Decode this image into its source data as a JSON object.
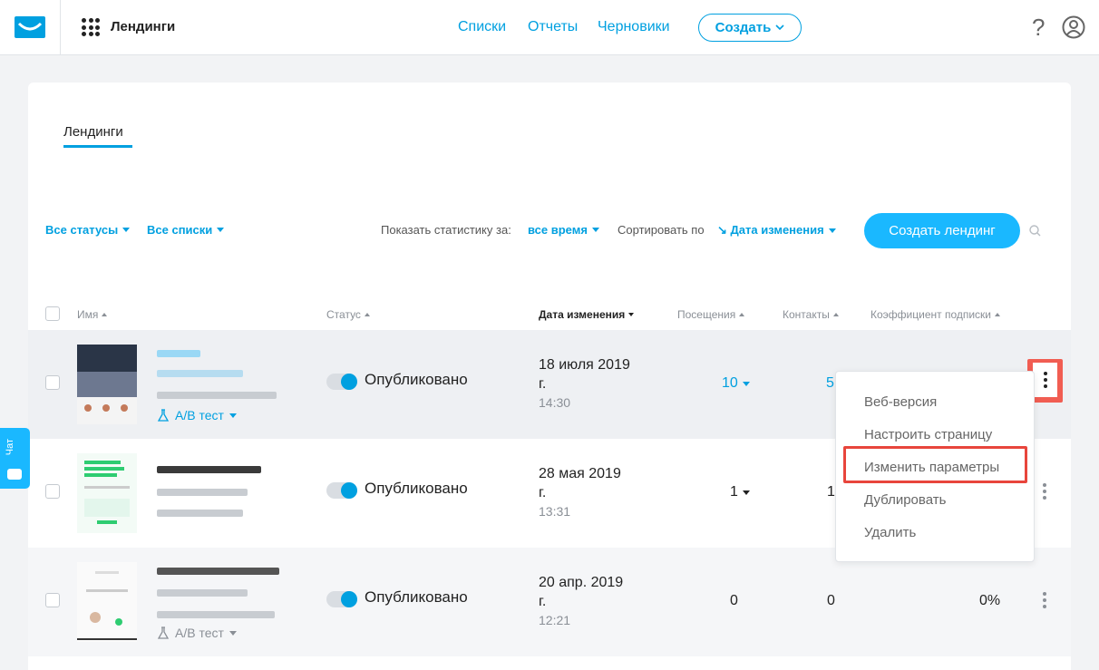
{
  "header": {
    "section_title": "Лендинги",
    "nav": [
      "Списки",
      "Отчеты",
      "Черновики"
    ],
    "create_label": "Создать",
    "help_symbol": "?"
  },
  "tabs": {
    "active": "Лендинги"
  },
  "filters": {
    "status": "Все статусы",
    "lists": "Все списки",
    "stats_label": "Показать статистику за:",
    "stats_value": "все время",
    "sort_label": "Сортировать по",
    "sort_value": "↘ Дата изменения",
    "create_landing": "Создать лендинг"
  },
  "table": {
    "columns": [
      "Имя",
      "Статус",
      "Дата изменения",
      "Посещения",
      "Контакты",
      "Коэффициент подписки"
    ],
    "rows": [
      {
        "ab_label": "A/B тест",
        "status": "Опубликовано",
        "date": "18 июля 2019",
        "date_suffix": "г.",
        "time": "14:30",
        "visits": "10",
        "contacts": "5",
        "rate": ""
      },
      {
        "ab_label": "",
        "status": "Опубликовано",
        "date": "28 мая 2019",
        "date_suffix": "г.",
        "time": "13:31",
        "visits": "1",
        "contacts": "1",
        "rate": ""
      },
      {
        "ab_label": "A/B тест",
        "status": "Опубликовано",
        "date": "20 апр. 2019",
        "date_suffix": "г.",
        "time": "12:21",
        "visits": "0",
        "contacts": "0",
        "rate": "0%"
      }
    ]
  },
  "menu": {
    "items": [
      "Веб-версия",
      "Настроить страницу",
      "Изменить параметры",
      "Дублировать",
      "Удалить"
    ]
  },
  "chat": {
    "label": "Чат"
  },
  "colors": {
    "accent": "#00a0e0",
    "cta": "#1ab8ff",
    "highlight": "#e8453c"
  }
}
